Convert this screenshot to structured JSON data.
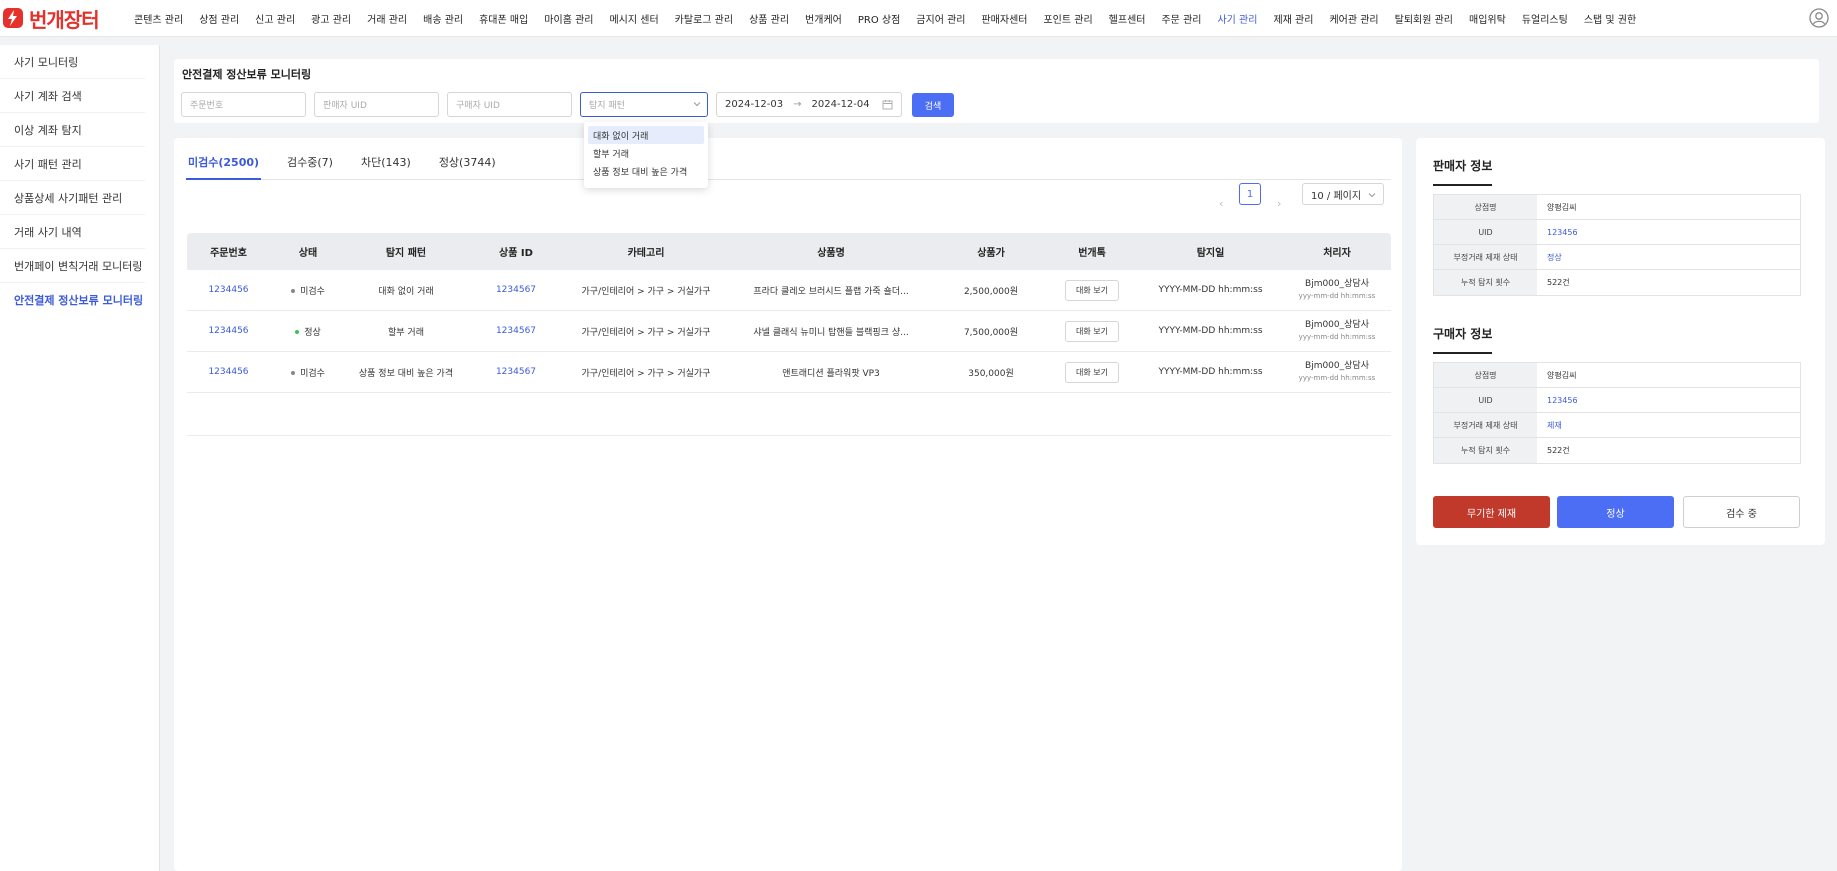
{
  "brand": {
    "name": "번개장터",
    "color": "#e5302b"
  },
  "nav": [
    {
      "label": "콘텐츠 관리",
      "active": false
    },
    {
      "label": "상점 관리",
      "active": false
    },
    {
      "label": "신고 관리",
      "active": false
    },
    {
      "label": "광고 관리",
      "active": false
    },
    {
      "label": "거래 관리",
      "active": false
    },
    {
      "label": "배송 관리",
      "active": false
    },
    {
      "label": "휴대폰 매입",
      "active": false
    },
    {
      "label": "마이홈 관리",
      "active": false
    },
    {
      "label": "메시지 센터",
      "active": false
    },
    {
      "label": "카탈로그 관리",
      "active": false
    },
    {
      "label": "상품 관리",
      "active": false
    },
    {
      "label": "번개케어",
      "active": false
    },
    {
      "label": "PRO 상점",
      "active": false
    },
    {
      "label": "금지어 관리",
      "active": false
    },
    {
      "label": "판매자센터",
      "active": false
    },
    {
      "label": "포인트 관리",
      "active": false
    },
    {
      "label": "헬프센터",
      "active": false
    },
    {
      "label": "주문 관리",
      "active": false
    },
    {
      "label": "사기 관리",
      "active": true
    },
    {
      "label": "제재 관리",
      "active": false
    },
    {
      "label": "케어관 관리",
      "active": false
    },
    {
      "label": "탈퇴회원 관리",
      "active": false
    },
    {
      "label": "매입위탁",
      "active": false
    },
    {
      "label": "듀얼리스팅",
      "active": false
    },
    {
      "label": "스탭 및 권한",
      "active": false
    }
  ],
  "sidebar": {
    "items": [
      {
        "label": "사기 모니터링"
      },
      {
        "label": "사기 계좌 검색"
      },
      {
        "label": "이상 계좌 탐지"
      },
      {
        "label": "사기 패턴 관리"
      },
      {
        "label": "상품상세 사기패턴 관리"
      },
      {
        "label": "거래 사기 내역"
      },
      {
        "label": "번개페이 변칙거래 모니터링"
      },
      {
        "label": "안전결제 정산보류 모니터링"
      }
    ]
  },
  "filters": {
    "title": "안전결제 정산보류 모니터링",
    "order_placeholder": "주문번호",
    "seller_placeholder": "판매자 UID",
    "buyer_placeholder": "구매자 UID",
    "pattern_placeholder": "탐지 패턴",
    "date_from": "2024-12-03",
    "date_arrow": "→",
    "date_to": "2024-12-04",
    "search_label": "검색"
  },
  "dropdown": {
    "options": [
      "대화 없이 거래",
      "할부 거래",
      "상품 정보 대비 높은 가격"
    ]
  },
  "tabs": [
    {
      "label": "미검수(2500)",
      "active": true
    },
    {
      "label": "검수중(7)",
      "active": false
    },
    {
      "label": "차단(143)",
      "active": false
    },
    {
      "label": "정상(3744)",
      "active": false
    }
  ],
  "pager": {
    "prev": "‹",
    "page": "1",
    "next": "›",
    "size": "10 / 페이지"
  },
  "table": {
    "headers": [
      "주문번호",
      "상태",
      "탐지 패턴",
      "상품 ID",
      "카테고리",
      "상품명",
      "상품가",
      "번개톡",
      "탐지일",
      "처리자"
    ],
    "rows": [
      {
        "order": "1234456",
        "status": "미검수",
        "status_color": "#888888",
        "pattern": "대화 없이 거래",
        "product_id": "1234567",
        "category": "가구/인테리어 > 가구 > 거실가구",
        "name": "프라다 클레오 브러시드 플랩 가죽 숄더...",
        "price": "2,500,000원",
        "chat": "대화 보기",
        "detected": "YYYY-MM-DD hh:mm:ss",
        "handler": "Bjm000_상담사",
        "handler_time": "yyy-mm-dd hh:mm:ss"
      },
      {
        "order": "1234456",
        "status": "정상",
        "status_color": "#40c057",
        "pattern": "할부 거래",
        "product_id": "1234567",
        "category": "가구/인테리어 > 가구 > 거실가구",
        "name": "샤넬 클래식 뉴미니 탑핸들 블랙핑크 샹...",
        "price": "7,500,000원",
        "chat": "대화 보기",
        "detected": "YYYY-MM-DD hh:mm:ss",
        "handler": "Bjm000_상담사",
        "handler_time": "yyy-mm-dd hh:mm:ss"
      },
      {
        "order": "1234456",
        "status": "미검수",
        "status_color": "#888888",
        "pattern": "상품 정보 대비 높은 가격",
        "product_id": "1234567",
        "category": "가구/인테리어 > 가구 > 거실가구",
        "name": "앤트래디션 플라워팟 VP3",
        "price": "350,000원",
        "chat": "대화 보기",
        "detected": "YYYY-MM-DD hh:mm:ss",
        "handler": "Bjm000_상담사",
        "handler_time": "yyy-mm-dd hh:mm:ss"
      }
    ]
  },
  "seller": {
    "title": "판매자 정보",
    "rows": [
      {
        "key": "상점명",
        "value": "양평김씨",
        "blue": false
      },
      {
        "key": "UID",
        "value": "123456",
        "blue": true
      },
      {
        "key": "부정거래 제재 상태",
        "value": "정상",
        "blue": true
      },
      {
        "key": "누적 탐지 횟수",
        "value": "522건",
        "blue": false
      }
    ]
  },
  "buyer": {
    "title": "구매자 정보",
    "rows": [
      {
        "key": "상점명",
        "value": "양평김씨",
        "blue": false
      },
      {
        "key": "UID",
        "value": "123456",
        "blue": true
      },
      {
        "key": "부정거래 제재 상태",
        "value": "제재",
        "blue": true
      },
      {
        "key": "누적 탐지 횟수",
        "value": "522건",
        "blue": false
      }
    ]
  },
  "actions": {
    "sanction": "무기한 제재",
    "normal": "정상",
    "reviewing": "검수 중"
  },
  "colors": {
    "accent": "#3b5bdb",
    "primary_button": "#4c6ef5",
    "danger": "#c0392b"
  }
}
